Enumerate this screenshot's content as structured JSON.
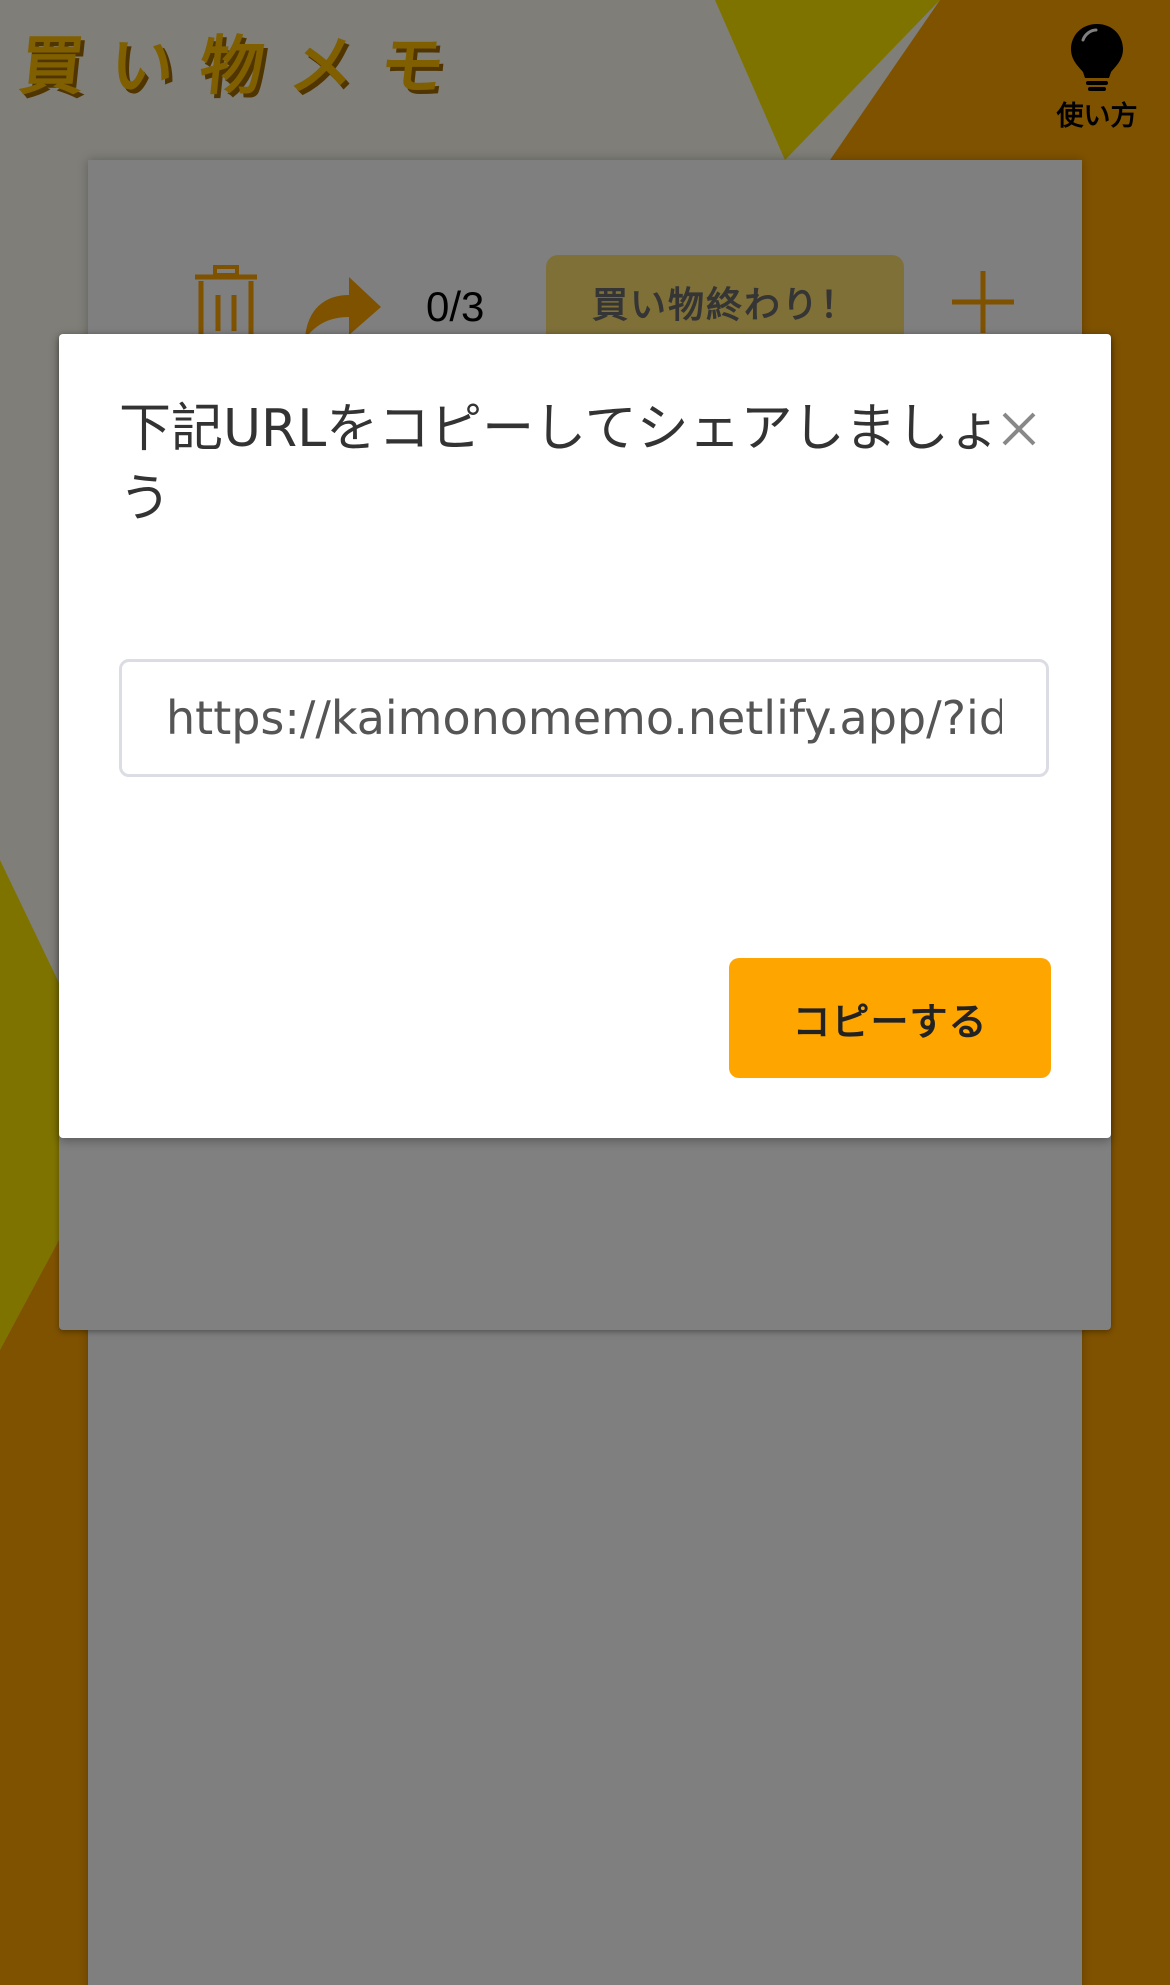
{
  "header": {
    "app_title": "買い物メモ",
    "help_label": "使い方",
    "help_icon": "lightbulb-icon"
  },
  "toolbar": {
    "trash_icon": "trash-icon",
    "share_icon": "share-arrow-icon",
    "counter": "0/3",
    "finish_label": "買い物終わり！",
    "add_icon": "plus-icon"
  },
  "modal": {
    "title": "下記URLをコピーしてシェアしましょう",
    "close_icon": "close-icon",
    "url_value": "https://kaimonomemo.netlify.app/?id=n",
    "copy_label": "コピーする"
  },
  "colors": {
    "accent": "#ffa500",
    "brand_yellow": "#ffbe00",
    "finish_button": "#ffe070",
    "overlay": "rgba(0,0,0,0.5)"
  }
}
